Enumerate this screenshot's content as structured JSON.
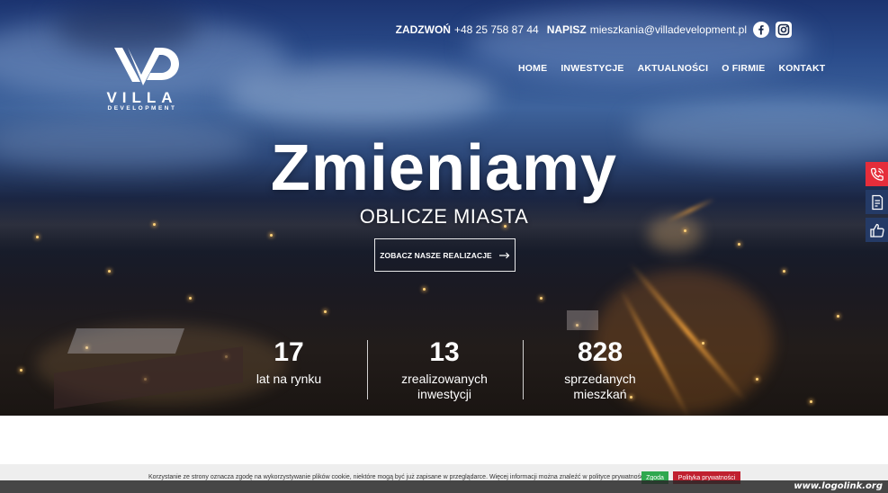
{
  "logo": {
    "title": "VILLA",
    "subtitle": "DEVELOPMENT"
  },
  "contact": {
    "phone_label": "ZADZWOŃ",
    "phone": "+48 25 758 87 44",
    "email_label": "NAPISZ",
    "email": "mieszkania@villadevelopment.pl"
  },
  "social": {
    "icons": [
      "facebook-icon",
      "instagram-icon"
    ]
  },
  "nav": {
    "items": [
      "HOME",
      "INWESTYCJE",
      "AKTUALNOŚCI",
      "O FIRMIE",
      "KONTAKT"
    ]
  },
  "hero": {
    "headline": "Zmieniamy",
    "subheadline": "OBLICZE MIASTA",
    "cta_label": "ZOBACZ NASZE REALIZACJE"
  },
  "stats": [
    {
      "value": "17",
      "label_line1": "lat na rynku",
      "label_line2": ""
    },
    {
      "value": "13",
      "label_line1": "zrealizowanych",
      "label_line2": "inwestycji"
    },
    {
      "value": "828",
      "label_line1": "sprzedanych",
      "label_line2": "mieszkań"
    }
  ],
  "side_buttons": [
    "phone-icon",
    "form-icon",
    "thumbs-up-icon"
  ],
  "cookie": {
    "text": "Korzystanie ze strony oznacza zgodę na wykorzystywanie plików cookie, niektóre mogą być już zapisane w przeglądarce. Więcej informacji można znaleźć w polityce prywatności.",
    "accept_label": "Zgoda",
    "policy_label": "Polityka prywatności"
  },
  "watermark": "www.logolink.org",
  "colors": {
    "call_button": "#e52d3a",
    "side_button": "#243a66",
    "accept": "#2fa84f",
    "policy": "#c0202f"
  }
}
